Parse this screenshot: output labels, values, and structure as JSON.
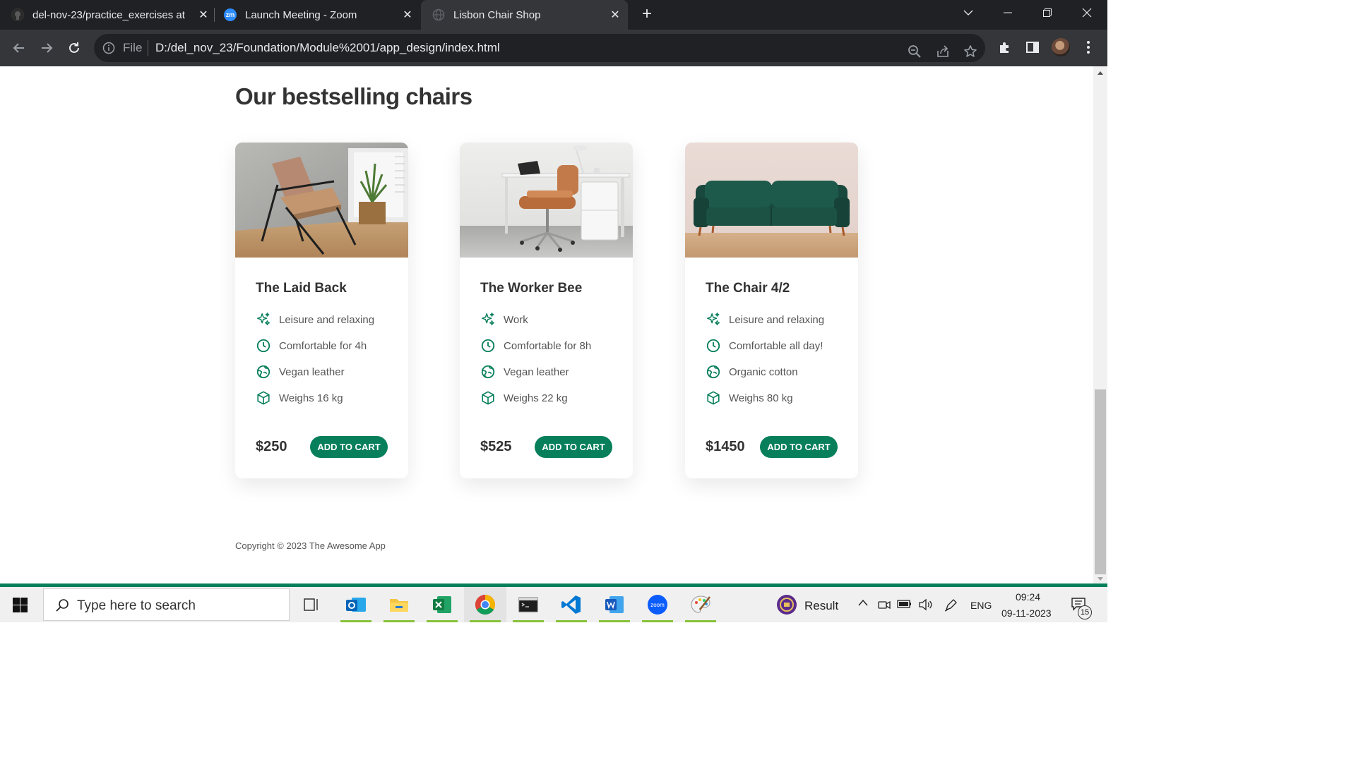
{
  "browser": {
    "tabs": [
      {
        "title": "del-nov-23/practice_exercises at",
        "icon": "github-icon",
        "active": false
      },
      {
        "title": "Launch Meeting - Zoom",
        "icon": "zoom-icon",
        "icon_text": "zm",
        "active": false
      },
      {
        "title": "Lisbon Chair Shop",
        "icon": "globe-icon",
        "active": true
      }
    ],
    "new_tab_label": "+",
    "address": {
      "scheme_label": "File",
      "url": "D:/del_nov_23/Foundation/Module%2001/app_design/index.html"
    }
  },
  "page": {
    "heading": "Our bestselling chairs",
    "accent_color": "#087f5b",
    "products": [
      {
        "name": "The Laid Back",
        "image": "lounge-chair-photo",
        "attributes": [
          {
            "icon": "sparkles-icon",
            "text": "Leisure and relaxing"
          },
          {
            "icon": "clock-icon",
            "text": "Comfortable for 4h"
          },
          {
            "icon": "globe-leaf-icon",
            "text": "Vegan leather"
          },
          {
            "icon": "cube-icon",
            "text": "Weighs 16 kg"
          }
        ],
        "price": "$250",
        "button": "ADD TO CART"
      },
      {
        "name": "The Worker Bee",
        "image": "office-chair-photo",
        "attributes": [
          {
            "icon": "sparkles-icon",
            "text": "Work"
          },
          {
            "icon": "clock-icon",
            "text": "Comfortable for 8h"
          },
          {
            "icon": "globe-leaf-icon",
            "text": "Vegan leather"
          },
          {
            "icon": "cube-icon",
            "text": "Weighs 22 kg"
          }
        ],
        "price": "$525",
        "button": "ADD TO CART"
      },
      {
        "name": "The Chair 4/2",
        "image": "green-sofa-photo",
        "attributes": [
          {
            "icon": "sparkles-icon",
            "text": "Leisure and relaxing"
          },
          {
            "icon": "clock-icon",
            "text": "Comfortable all day!"
          },
          {
            "icon": "globe-leaf-icon",
            "text": "Organic cotton"
          },
          {
            "icon": "cube-icon",
            "text": "Weighs 80 kg"
          }
        ],
        "price": "$1450",
        "button": "ADD TO CART"
      }
    ],
    "footer": "Copyright © 2023 The Awesome App"
  },
  "taskbar": {
    "search_placeholder": "Type here to search",
    "apps": [
      "task-view-icon",
      "outlook-icon",
      "file-explorer-icon",
      "excel-icon",
      "chrome-icon",
      "terminal-icon",
      "vscode-icon",
      "word-icon",
      "zoom-icon",
      "paint-icon"
    ],
    "widget_label": "Result",
    "language": "ENG",
    "time": "09:24",
    "date": "09-11-2023",
    "notification_count": "15"
  }
}
